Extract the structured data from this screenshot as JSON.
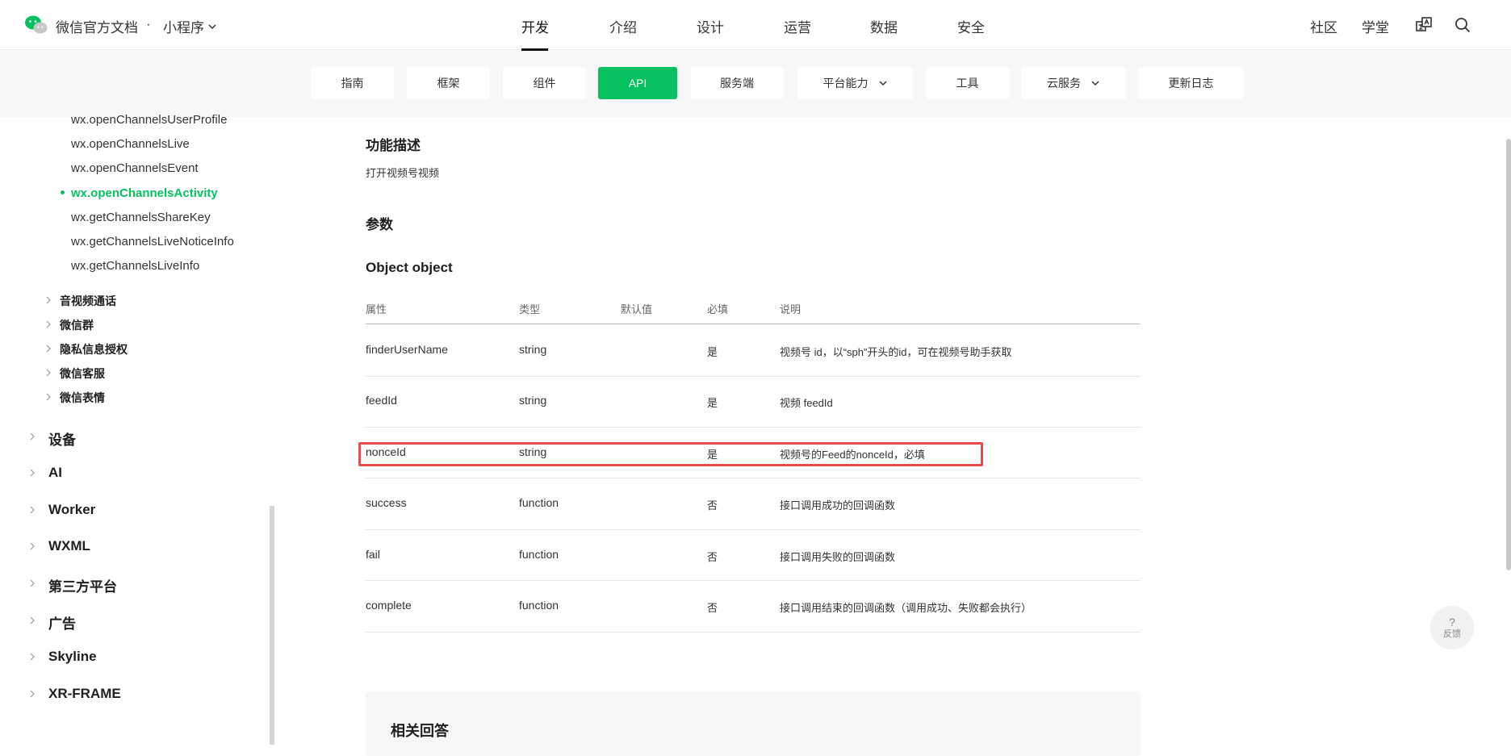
{
  "header": {
    "brand": "微信官方文档",
    "brand_dot": "·",
    "brand_sub": "小程序",
    "nav": [
      {
        "label": "开发"
      },
      {
        "label": "介绍"
      },
      {
        "label": "设计"
      },
      {
        "label": "运营"
      },
      {
        "label": "数据"
      },
      {
        "label": "安全"
      }
    ],
    "right_nav": [
      {
        "label": "社区"
      },
      {
        "label": "学堂"
      }
    ],
    "icons": [
      "translate-icon",
      "search-icon"
    ]
  },
  "subnav": [
    {
      "label": "指南"
    },
    {
      "label": "框架"
    },
    {
      "label": "组件"
    },
    {
      "label": "API"
    },
    {
      "label": "服务端"
    },
    {
      "label": "平台能力"
    },
    {
      "label": "工具"
    },
    {
      "label": "云服务"
    },
    {
      "label": "更新日志"
    }
  ],
  "sidebar": {
    "sub_items": [
      {
        "label": "wx.openChannelsUserProfile"
      },
      {
        "label": "wx.openChannelsLive"
      },
      {
        "label": "wx.openChannelsEvent"
      },
      {
        "label": "wx.openChannelsActivity"
      },
      {
        "label": "wx.getChannelsShareKey"
      },
      {
        "label": "wx.getChannelsLiveNoticeInfo"
      },
      {
        "label": "wx.getChannelsLiveInfo"
      }
    ],
    "groups": [
      {
        "label": "音视频通话"
      },
      {
        "label": "微信群"
      },
      {
        "label": "隐私信息授权"
      },
      {
        "label": "微信客服"
      },
      {
        "label": "微信表情"
      }
    ],
    "top_items": [
      {
        "label": "设备"
      },
      {
        "label": "AI"
      },
      {
        "label": "Worker"
      },
      {
        "label": "WXML"
      },
      {
        "label": "第三方平台"
      },
      {
        "label": "广告"
      },
      {
        "label": "Skyline"
      },
      {
        "label": "XR-FRAME"
      }
    ]
  },
  "content": {
    "func_heading": "功能描述",
    "func_desc": "打开视频号视频",
    "params_heading": "参数",
    "object_heading": "Object object",
    "table": {
      "headers": [
        "属性",
        "类型",
        "默认值",
        "必填",
        "说明"
      ],
      "rows": [
        {
          "name": "finderUserName",
          "type": "string",
          "default": "",
          "required": "是",
          "desc": "视频号 id，以“sph”开头的id，可在视频号助手获取"
        },
        {
          "name": "feedId",
          "type": "string",
          "default": "",
          "required": "是",
          "desc": "视频 feedId"
        },
        {
          "name": "nonceId",
          "type": "string",
          "default": "",
          "required": "是",
          "desc": "视频号的Feed的nonceId，必填"
        },
        {
          "name": "success",
          "type": "function",
          "default": "",
          "required": "否",
          "desc": "接口调用成功的回调函数"
        },
        {
          "name": "fail",
          "type": "function",
          "default": "",
          "required": "否",
          "desc": "接口调用失败的回调函数"
        },
        {
          "name": "complete",
          "type": "function",
          "default": "",
          "required": "否",
          "desc": "接口调用结束的回调函数（调用成功、失败都会执行）"
        }
      ]
    },
    "related_title": "相关回答"
  },
  "feedback": {
    "q": "?",
    "label": "反馈"
  },
  "colors": {
    "accent": "#07c160",
    "highlight": "#e54d4d"
  }
}
